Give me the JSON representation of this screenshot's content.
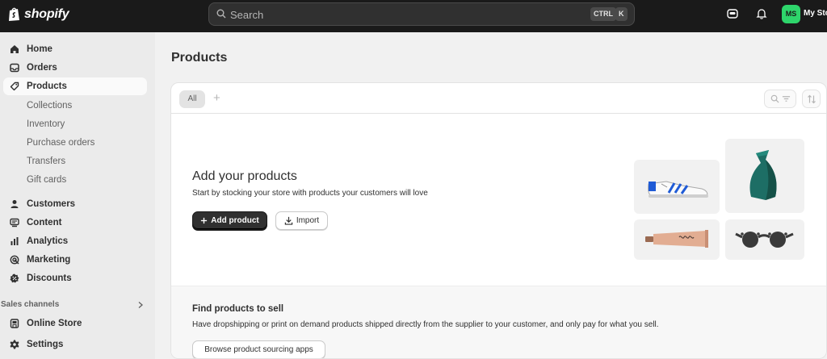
{
  "topbar": {
    "logo_text": "shopify",
    "search_placeholder": "Search",
    "shortcut_ctrl": "CTRL",
    "shortcut_k": "K",
    "avatar_initials": "MS",
    "store_name": "My Store"
  },
  "sidebar": {
    "items": [
      {
        "label": "Home",
        "icon": "home-icon"
      },
      {
        "label": "Orders",
        "icon": "inbox-icon"
      },
      {
        "label": "Products",
        "icon": "tag-icon"
      },
      {
        "label": "Customers",
        "icon": "person-icon"
      },
      {
        "label": "Content",
        "icon": "content-icon"
      },
      {
        "label": "Analytics",
        "icon": "bar-chart-icon"
      },
      {
        "label": "Marketing",
        "icon": "target-icon"
      },
      {
        "label": "Discounts",
        "icon": "discount-icon"
      },
      {
        "label": "Online Store",
        "icon": "store-icon"
      },
      {
        "label": "Settings",
        "icon": "gear-icon"
      }
    ],
    "product_subitems": [
      "Collections",
      "Inventory",
      "Purchase orders",
      "Transfers",
      "Gift cards"
    ],
    "sales_channels_label": "Sales channels"
  },
  "main": {
    "page_title": "Products",
    "tabs": {
      "all": "All",
      "add": "+"
    },
    "empty_state": {
      "heading": "Add your products",
      "subheading": "Start by stocking your store with products your customers will love",
      "add_button": "Add product",
      "import_button": "Import"
    },
    "find_products": {
      "title": "Find products to sell",
      "description": "Have dropshipping or print on demand products shipped directly from the supplier to your customer, and only pay for what you sell.",
      "button": "Browse product sourcing apps"
    }
  },
  "colors": {
    "topbar": "#1a1a1a",
    "avatar": "#2ed56b",
    "primary_button": "#303030",
    "sidebar_bg": "#ebebeb"
  }
}
